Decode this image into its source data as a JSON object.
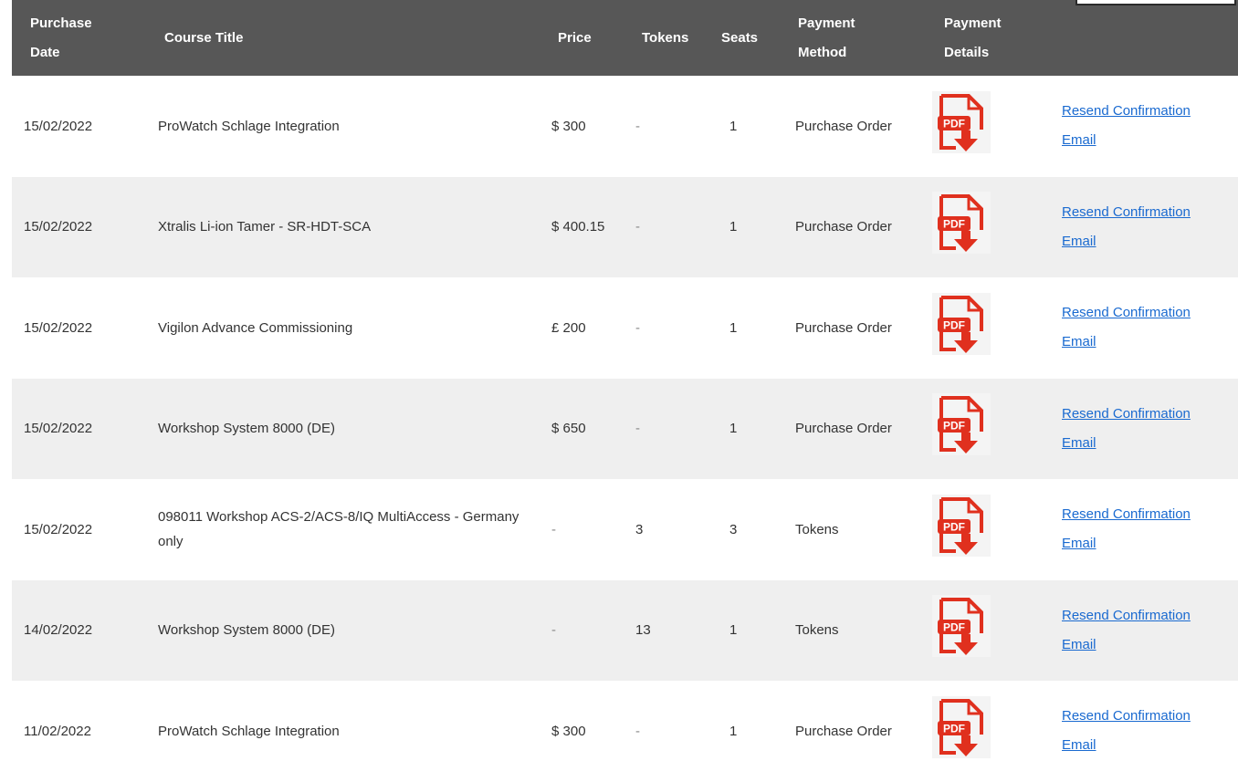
{
  "table": {
    "headers": {
      "date": [
        "Purchase",
        "Date"
      ],
      "title": "Course Title",
      "price": "Price",
      "tokens": "Tokens",
      "seats": "Seats",
      "method": [
        "Payment",
        "Method"
      ],
      "details": [
        "Payment",
        "Details"
      ]
    },
    "pdf_label": "PDF",
    "link_label": "Resend Confirmation Email",
    "rows": [
      {
        "date": "15/02/2022",
        "title": "ProWatch Schlage Integration",
        "price": "$ 300",
        "tokens": "-",
        "seats": "1",
        "method": "Purchase Order"
      },
      {
        "date": "15/02/2022",
        "title": "Xtralis Li-ion Tamer - SR-HDT-SCA",
        "price": "$ 400.15",
        "tokens": "-",
        "seats": "1",
        "method": "Purchase Order"
      },
      {
        "date": "15/02/2022",
        "title": "Vigilon Advance Commissioning",
        "price": "£ 200",
        "tokens": "-",
        "seats": "1",
        "method": "Purchase Order"
      },
      {
        "date": "15/02/2022",
        "title": "Workshop System 8000 (DE)",
        "price": "$ 650",
        "tokens": "-",
        "seats": "1",
        "method": "Purchase Order"
      },
      {
        "date": "15/02/2022",
        "title": "098011 Workshop ACS-2/ACS-8/IQ MultiAccess - Germany only",
        "price": "-",
        "tokens": "3",
        "seats": "3",
        "method": "Tokens"
      },
      {
        "date": "14/02/2022",
        "title": "Workshop System 8000 (DE)",
        "price": "-",
        "tokens": "13",
        "seats": "1",
        "method": "Tokens"
      },
      {
        "date": "11/02/2022",
        "title": "ProWatch Schlage Integration",
        "price": "$ 300",
        "tokens": "-",
        "seats": "1",
        "method": "Purchase Order"
      }
    ]
  },
  "colors": {
    "header_bg": "#575757",
    "alt_row_bg": "#efefef",
    "link": "#1a6ad0",
    "pdf_red": "#e0301e"
  }
}
